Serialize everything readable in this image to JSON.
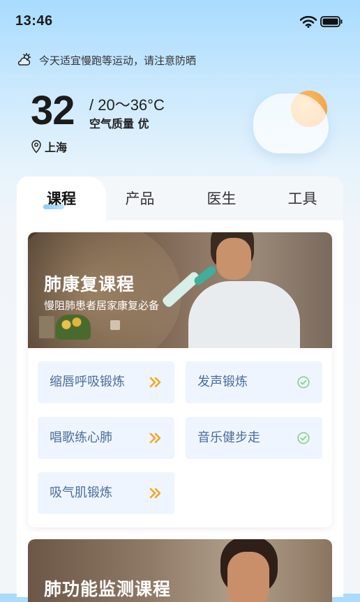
{
  "status_bar": {
    "time": "13:46",
    "wifi_icon": "wifi-icon",
    "battery_icon": "battery-icon"
  },
  "weather": {
    "tip_icon": "cloud-sun-icon",
    "tip": "今天适宜慢跑等运动，请注意防晒",
    "temperature": "32",
    "range": "/ 20～36°C",
    "air_quality": "空气质量 优",
    "location_icon": "location-pin-icon",
    "location": "上海",
    "illustration": "sun-behind-cloud"
  },
  "tabs": [
    {
      "label": "课程",
      "active": true
    },
    {
      "label": "产品",
      "active": false
    },
    {
      "label": "医生",
      "active": false
    },
    {
      "label": "工具",
      "active": false
    }
  ],
  "course_card": {
    "title": "肺康复课程",
    "subtitle": "慢阻肺患者居家康复必备",
    "items": [
      {
        "label": "缩唇呼吸锻炼",
        "icon": "double-chevron-right-icon",
        "status": "pending"
      },
      {
        "label": "发声锻炼",
        "icon": "check-circle-icon",
        "status": "done"
      },
      {
        "label": "唱歌练心肺",
        "icon": "double-chevron-right-icon",
        "status": "pending"
      },
      {
        "label": "音乐健步走",
        "icon": "check-circle-icon",
        "status": "done"
      },
      {
        "label": "吸气肌锻炼",
        "icon": "double-chevron-right-icon",
        "status": "pending"
      }
    ]
  },
  "course_card_2": {
    "title": "肺功能监测课程"
  },
  "colors": {
    "accent_orange": "#f5a623",
    "check_green": "#7ed07f",
    "item_bg": "#eef5fe",
    "item_text": "#4a6d99",
    "tab_indicator": "#8fd0f8"
  }
}
